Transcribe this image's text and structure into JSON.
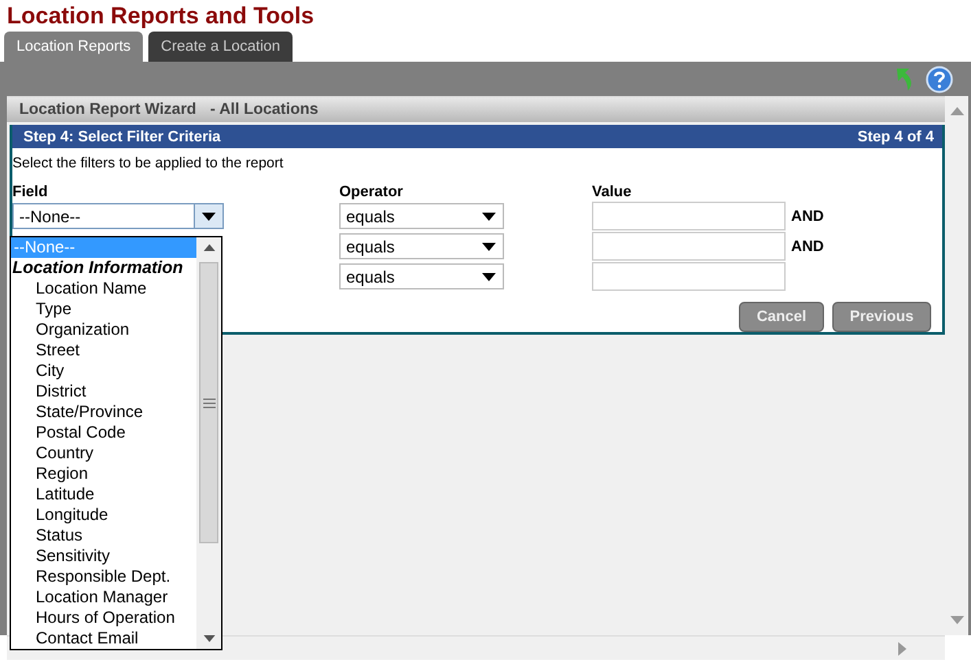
{
  "title": "Location Reports and Tools",
  "tabs": [
    {
      "label": "Location Reports",
      "selected": true
    },
    {
      "label": "Create a Location",
      "selected": false
    }
  ],
  "wizard": {
    "title": "Location Report Wizard",
    "subtitle": "- All Locations"
  },
  "step": {
    "title": "Step 4: Select Filter Criteria",
    "counter": "Step 4 of 4"
  },
  "instructions": "Select the filters to be applied to the report",
  "columns": [
    "Field",
    "Operator",
    "Value"
  ],
  "filters": [
    {
      "field": "--None--",
      "operator": "equals",
      "conjunction": "AND"
    },
    {
      "operator": "equals",
      "conjunction": "AND"
    },
    {
      "operator": "equals"
    }
  ],
  "field_list": [
    {
      "kind": "option",
      "label": "--None--",
      "selected": true
    },
    {
      "kind": "group",
      "label": "Location Information",
      "selected": false
    },
    {
      "kind": "option",
      "label": "Location Name",
      "selected": false
    },
    {
      "kind": "option",
      "label": "Type",
      "selected": false
    },
    {
      "kind": "option",
      "label": "Organization",
      "selected": false
    },
    {
      "kind": "option",
      "label": "Street",
      "selected": false
    },
    {
      "kind": "option",
      "label": "City",
      "selected": false
    },
    {
      "kind": "option",
      "label": "District",
      "selected": false
    },
    {
      "kind": "option",
      "label": "State/Province",
      "selected": false
    },
    {
      "kind": "option",
      "label": "Postal Code",
      "selected": false
    },
    {
      "kind": "option",
      "label": "Country",
      "selected": false
    },
    {
      "kind": "option",
      "label": "Region",
      "selected": false
    },
    {
      "kind": "option",
      "label": "Latitude",
      "selected": false
    },
    {
      "kind": "option",
      "label": "Longitude",
      "selected": false
    },
    {
      "kind": "option",
      "label": "Status",
      "selected": false
    },
    {
      "kind": "option",
      "label": "Sensitivity",
      "selected": false
    },
    {
      "kind": "option",
      "label": "Responsible Dept.",
      "selected": false
    },
    {
      "kind": "option",
      "label": "Location Manager",
      "selected": false
    },
    {
      "kind": "option",
      "label": "Hours of Operation",
      "selected": false
    },
    {
      "kind": "option",
      "label": "Contact Email",
      "selected": false
    }
  ],
  "buttons": [
    "Cancel",
    "Previous"
  ]
}
